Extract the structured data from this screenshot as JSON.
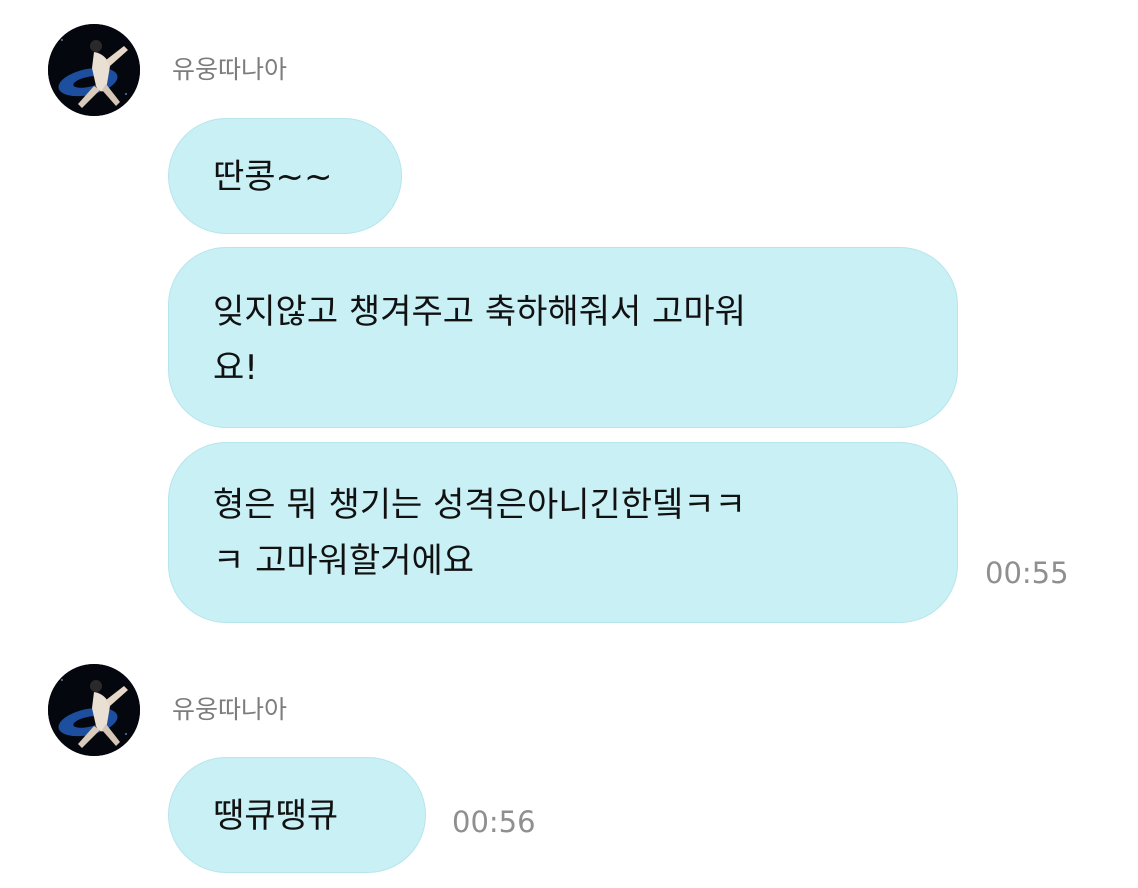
{
  "groups": [
    {
      "sender": "유웅따나아",
      "messages": [
        {
          "lines": [
            "딴콩~~"
          ]
        },
        {
          "lines": [
            "잊지않고 챙겨주고 축하해줘서 고마워",
            "요!"
          ]
        },
        {
          "lines": [
            "형은 뭐 챙기는 성격은아니긴한뎈ㅋㅋ",
            "ㅋ 고마워할거에요"
          ]
        }
      ],
      "time": "00:55"
    },
    {
      "sender": "유웅따나아",
      "messages": [
        {
          "lines": [
            "땡큐땡큐"
          ]
        }
      ],
      "time": "00:56"
    }
  ],
  "colors": {
    "bubble": "#c8f0f5",
    "sender_name": "#7d7d7d",
    "timestamp": "#8f8f8f"
  },
  "icons": {
    "avatar": "profile-photo-avatar-icon"
  }
}
